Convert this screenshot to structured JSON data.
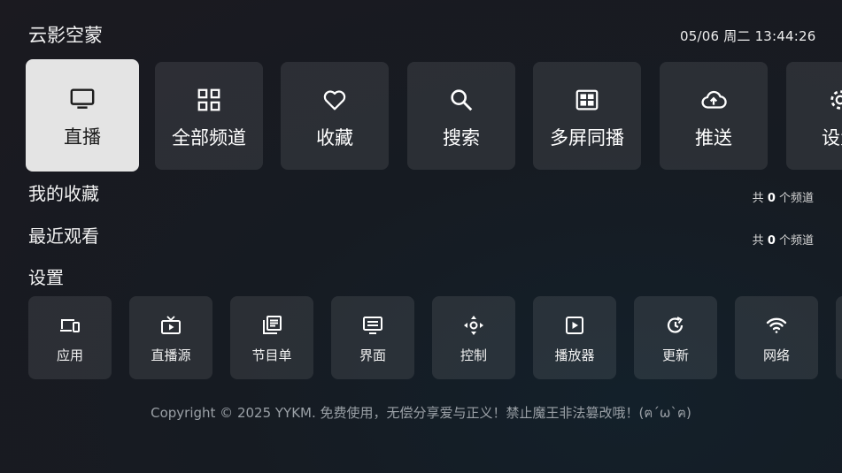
{
  "header": {
    "app_title": "云影空蒙",
    "datetime": "05/06 周二 13:44:26"
  },
  "main_nav": [
    {
      "label": "直播",
      "icon": "tv-icon",
      "active": true
    },
    {
      "label": "全部频道",
      "icon": "grid-icon"
    },
    {
      "label": "收藏",
      "icon": "heart-icon"
    },
    {
      "label": "搜索",
      "icon": "search-icon"
    },
    {
      "label": "多屏同播",
      "icon": "multiscreen-icon"
    },
    {
      "label": "推送",
      "icon": "cloud-upload-icon"
    },
    {
      "label": "设置",
      "icon": "gear-icon"
    }
  ],
  "sections": {
    "favorites": {
      "title": "我的收藏",
      "count_prefix": "共 ",
      "count": "0",
      "count_suffix": " 个频道"
    },
    "recent": {
      "title": "最近观看",
      "count_prefix": "共 ",
      "count": "0",
      "count_suffix": " 个频道"
    },
    "settings": {
      "title": "设置"
    }
  },
  "settings_items": [
    {
      "label": "应用",
      "icon": "devices-icon"
    },
    {
      "label": "直播源",
      "icon": "live-tv-icon"
    },
    {
      "label": "节目单",
      "icon": "library-books-icon"
    },
    {
      "label": "界面",
      "icon": "monitor-settings-icon"
    },
    {
      "label": "控制",
      "icon": "dpad-icon"
    },
    {
      "label": "播放器",
      "icon": "play-box-icon"
    },
    {
      "label": "更新",
      "icon": "update-icon"
    },
    {
      "label": "网络",
      "icon": "wifi-icon"
    }
  ],
  "footer": {
    "text": "Copyright © 2025 YYKM. 免费使用，无偿分享爱与正义！禁止魔王非法篡改哦！(ฅ´ω`ฅ)"
  },
  "colors": {
    "active_tile_bg": "#e4e4e4",
    "tile_bg": "rgba(255,255,255,0.09)",
    "footer_text": "#9aa0a6"
  }
}
